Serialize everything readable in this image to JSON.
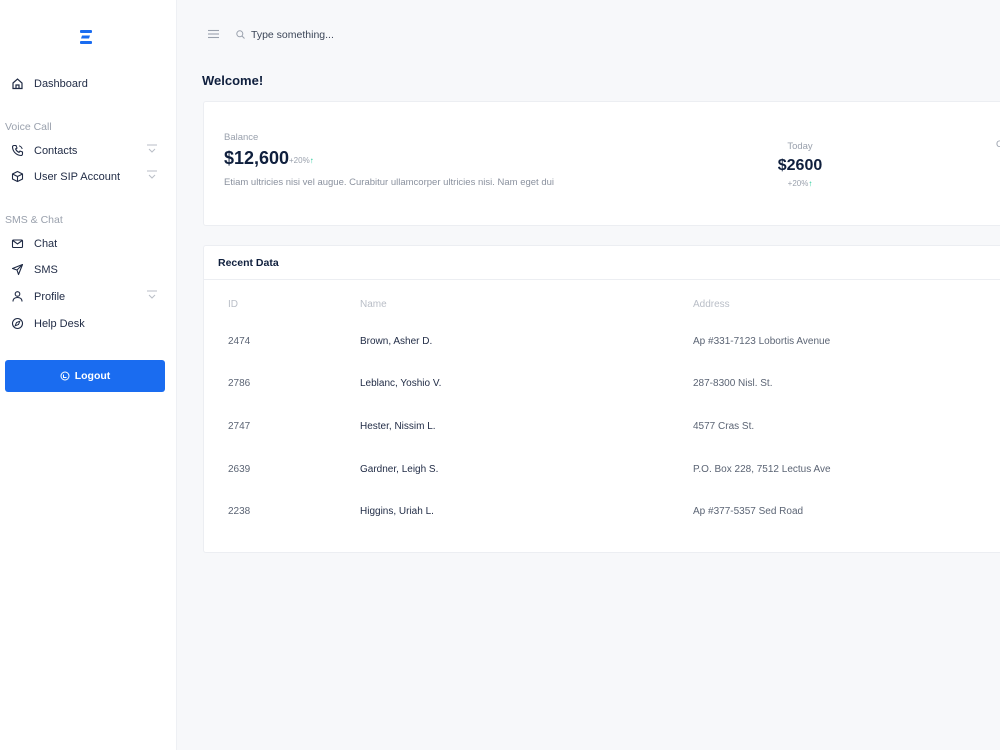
{
  "sidebar": {
    "dashboard": "Dashboard",
    "section_voice": "Voice Call",
    "contacts": "Contacts",
    "user_sip": "User SIP Account",
    "section_sms": "SMS & Chat",
    "chat": "Chat",
    "sms": "SMS",
    "profile": "Profile",
    "help": "Help Desk",
    "logout": "Logout"
  },
  "topbar": {
    "search_placeholder": "Type something..."
  },
  "page": {
    "title": "Welcome!"
  },
  "balance": {
    "label": "Balance",
    "value": "$12,600",
    "change": "+20%",
    "description": "Etiam ultricies nisi vel augue. Curabitur ullamcorper ultricies nisi. Nam eget dui",
    "today_label": "Today",
    "today_value": "$2600",
    "today_change": "+20%",
    "cut_label": "C"
  },
  "recent": {
    "title": "Recent Data",
    "headers": {
      "id": "ID",
      "name": "Name",
      "address": "Address"
    },
    "rows": [
      {
        "id": "2474",
        "name": "Brown, Asher D.",
        "address": "Ap #331-7123 Lobortis Avenue"
      },
      {
        "id": "2786",
        "name": "Leblanc, Yoshio V.",
        "address": "287-8300 Nisl. St."
      },
      {
        "id": "2747",
        "name": "Hester, Nissim L.",
        "address": "4577 Cras St."
      },
      {
        "id": "2639",
        "name": "Gardner, Leigh S.",
        "address": "P.O. Box 228, 7512 Lectus Ave"
      },
      {
        "id": "2238",
        "name": "Higgins, Uriah L.",
        "address": "Ap #377-5357 Sed Road"
      }
    ]
  },
  "colors": {
    "accent": "#1a6cf0",
    "positive": "#20c997",
    "title": "#0f1f3d"
  },
  "icons": {
    "logo": "brand-logo-icon",
    "dashboard": "home-icon",
    "contacts": "phone-icon",
    "user_sip": "box-icon",
    "chat": "mail-icon",
    "sms": "send-icon",
    "profile": "user-icon",
    "help": "compass-icon",
    "logout": "power-icon",
    "menu": "menu-icon",
    "search": "search-icon"
  }
}
